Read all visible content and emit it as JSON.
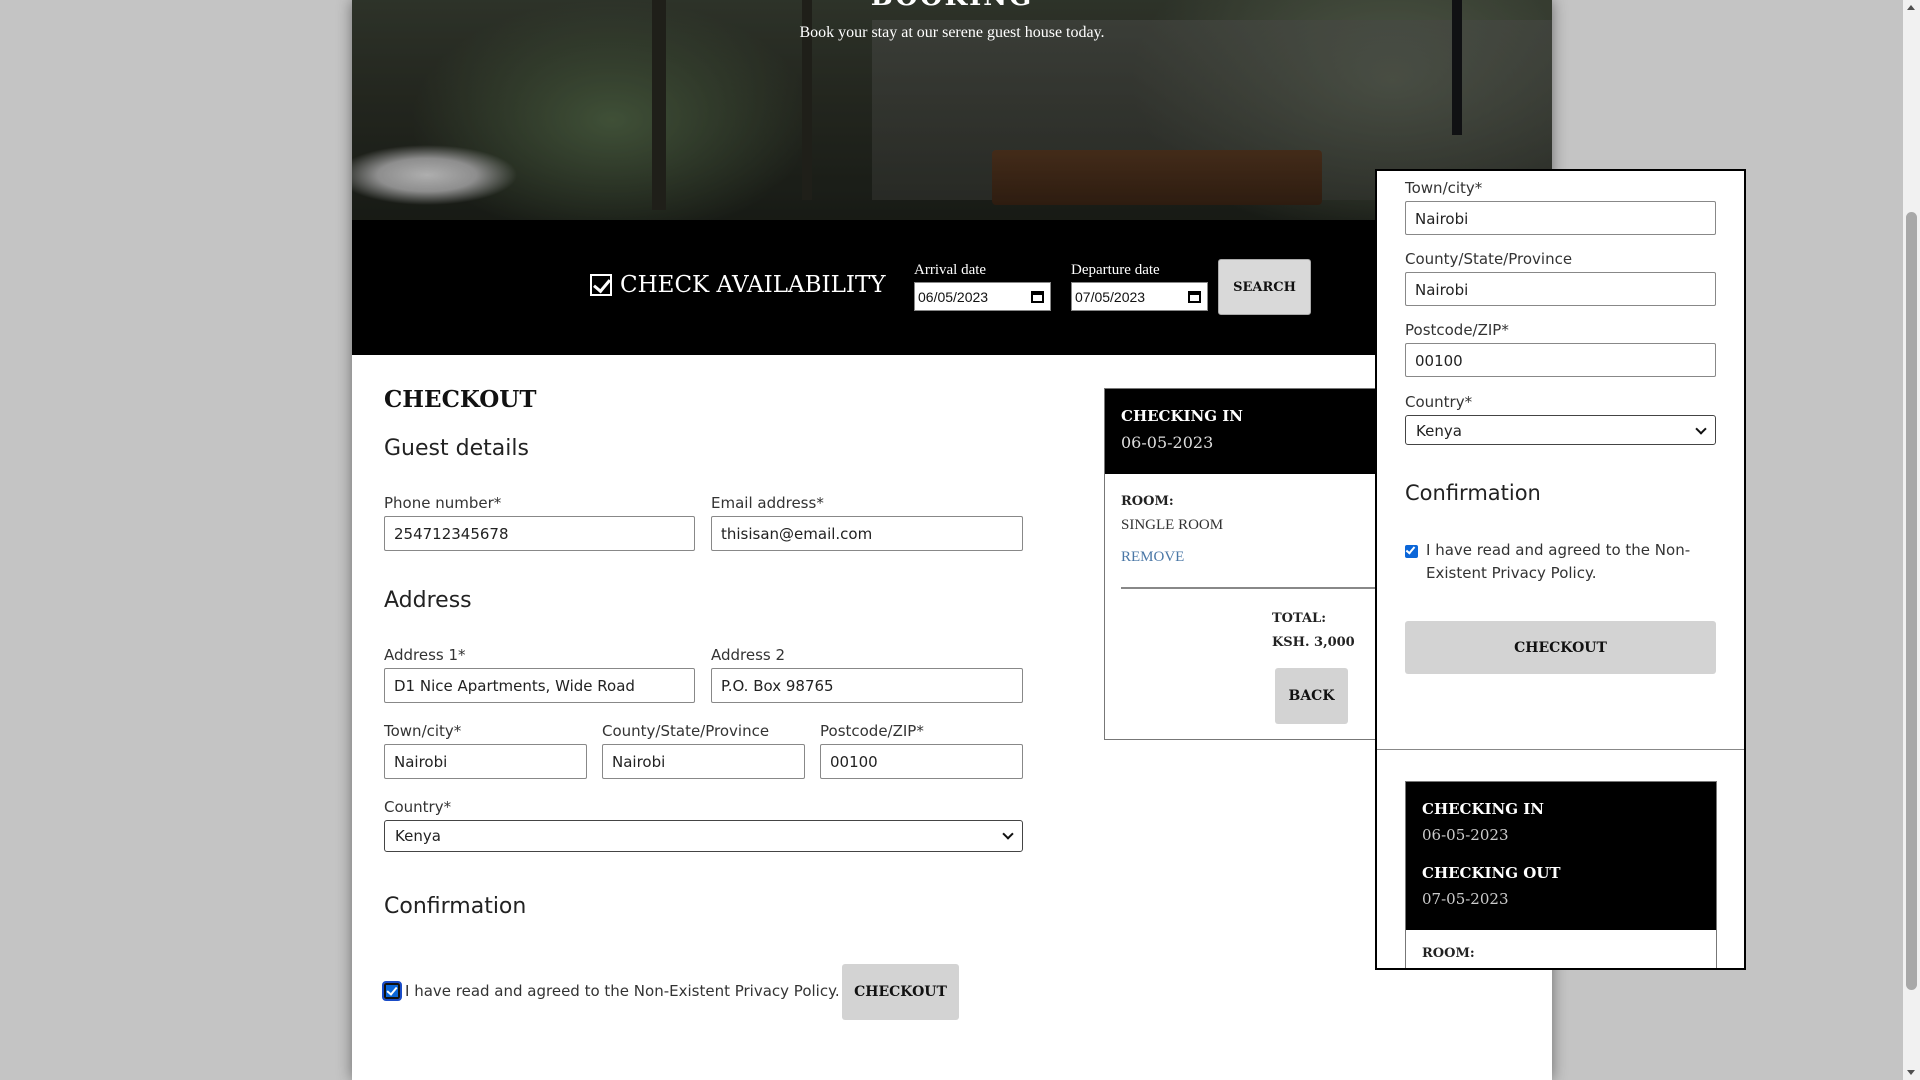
{
  "hero": {
    "title": "BOOKING",
    "subtitle": "Book your stay at our serene guest house today."
  },
  "availability": {
    "title": "CHECK AVAILABILITY",
    "arrival_label": "Arrival date",
    "arrival_value": "06/05/2023",
    "departure_label": "Departure date",
    "departure_value": "07/05/2023",
    "search_label": "SEARCH"
  },
  "checkout": {
    "title": "CHECKOUT",
    "guest_heading": "Guest details",
    "phone_label": "Phone number*",
    "phone_value": "254712345678",
    "email_label": "Email address*",
    "email_value": "thisisan@email.com",
    "address_heading": "Address",
    "address1_label": "Address 1*",
    "address1_value": "D1 Nice Apartments, Wide Road",
    "address2_label": "Address 2",
    "address2_value": "P.O. Box 98765",
    "town_label": "Town/city*",
    "town_value": "Nairobi",
    "county_label": "County/State/Province",
    "county_value": "Nairobi",
    "postcode_label": "Postcode/ZIP*",
    "postcode_value": "00100",
    "country_label": "Country*",
    "country_value": "Kenya",
    "confirmation_heading": "Confirmation",
    "agree_text": "I have read and agreed to the Non-Existent Privacy Policy.",
    "checkout_button": "CHECKOUT"
  },
  "summary": {
    "checkin_label": "CHECKING IN",
    "checkin_date": "06-05-2023",
    "checkout_label": "CHECKING OUT",
    "checkout_date": "07-05-2023",
    "room_label": "ROOM:",
    "room_value": "SINGLE ROOM",
    "remove_label": "REMOVE",
    "total_label": "TOTAL:",
    "total_value": "KSH. 3,000",
    "back_button": "BACK"
  },
  "panel": {
    "town_label": "Town/city*",
    "town_value": "Nairobi",
    "county_label": "County/State/Province",
    "county_value": "Nairobi",
    "postcode_label": "Postcode/ZIP*",
    "postcode_value": "00100",
    "country_label": "Country*",
    "country_value": "Kenya",
    "confirmation_heading": "Confirmation",
    "agree_text": "I have read and agreed to the Non-Existent Privacy Policy.",
    "checkout_button": "CHECKOUT"
  }
}
